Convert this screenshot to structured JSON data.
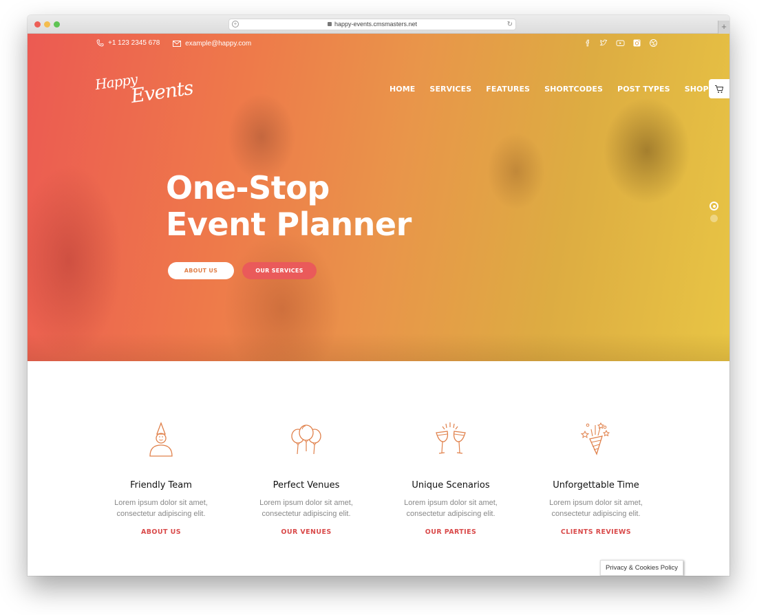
{
  "browser": {
    "url": "happy-events.cmsmasters.net"
  },
  "topbar": {
    "phone": "+1 123 2345 678",
    "email": "example@happy.com",
    "social": [
      "facebook",
      "twitter",
      "youtube",
      "instagram",
      "dribbble"
    ]
  },
  "logo": {
    "line1": "Happy",
    "line2": "Events"
  },
  "nav": {
    "items": [
      {
        "label": "HOME"
      },
      {
        "label": "SERVICES"
      },
      {
        "label": "FEATURES"
      },
      {
        "label": "SHORTCODES"
      },
      {
        "label": "POST TYPES"
      },
      {
        "label": "SHOP"
      }
    ]
  },
  "hero": {
    "title_line1": "One-Stop",
    "title_line2": "Event Planner",
    "btn_about": "ABOUT US",
    "btn_services": "OUR SERVICES",
    "slides_total": 2,
    "slide_active": 1
  },
  "features": [
    {
      "icon": "party-person-icon",
      "title": "Friendly Team",
      "text1": "Lorem ipsum dolor sit amet,",
      "text2": "consectetur adipiscing elit.",
      "link": "ABOUT US"
    },
    {
      "icon": "balloons-icon",
      "title": "Perfect Venues",
      "text1": "Lorem ipsum dolor sit amet,",
      "text2": "consectetur adipiscing elit.",
      "link": "OUR VENUES"
    },
    {
      "icon": "cheers-glasses-icon",
      "title": "Unique Scenarios",
      "text1": "Lorem ipsum dolor sit amet,",
      "text2": "consectetur adipiscing elit.",
      "link": "OUR PARTIES"
    },
    {
      "icon": "party-popper-icon",
      "title": "Unforgettable Time",
      "text1": "Lorem ipsum dolor sit amet,",
      "text2": "consectetur adipiscing elit.",
      "link": "CLIENTS REVIEWS"
    }
  ],
  "cookie": {
    "label": "Privacy & Cookies Policy"
  },
  "colors": {
    "accent": "#d94a4a",
    "icon": "#e0804a",
    "services_btn": "#ea5a5a"
  }
}
